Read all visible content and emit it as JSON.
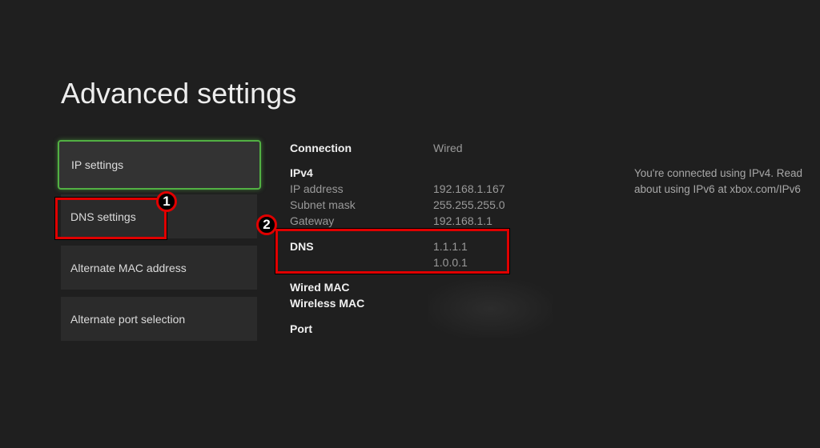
{
  "page": {
    "title": "Advanced settings"
  },
  "menu": [
    {
      "label": "IP settings",
      "selected": true
    },
    {
      "label": "DNS settings"
    },
    {
      "label": "Alternate MAC address"
    },
    {
      "label": "Alternate port selection"
    }
  ],
  "details": {
    "connection_label": "Connection",
    "connection_value": "Wired",
    "ipv4_label": "IPv4",
    "ip_label": "IP address",
    "ip_value": "192.168.1.167",
    "subnet_label": "Subnet mask",
    "subnet_value": "255.255.255.0",
    "gateway_label": "Gateway",
    "gateway_value": "192.168.1.1",
    "dns_label": "DNS",
    "dns_primary": "1.1.1.1",
    "dns_secondary": "1.0.0.1",
    "wired_mac_label": "Wired MAC",
    "wireless_mac_label": "Wireless MAC",
    "port_label": "Port"
  },
  "info": "You're connected using IPv4. Read about using IPv6 at xbox.com/IPv6",
  "annotations": {
    "badge1": "1",
    "badge2": "2",
    "color": "#e00000",
    "accent": "#52b043"
  }
}
